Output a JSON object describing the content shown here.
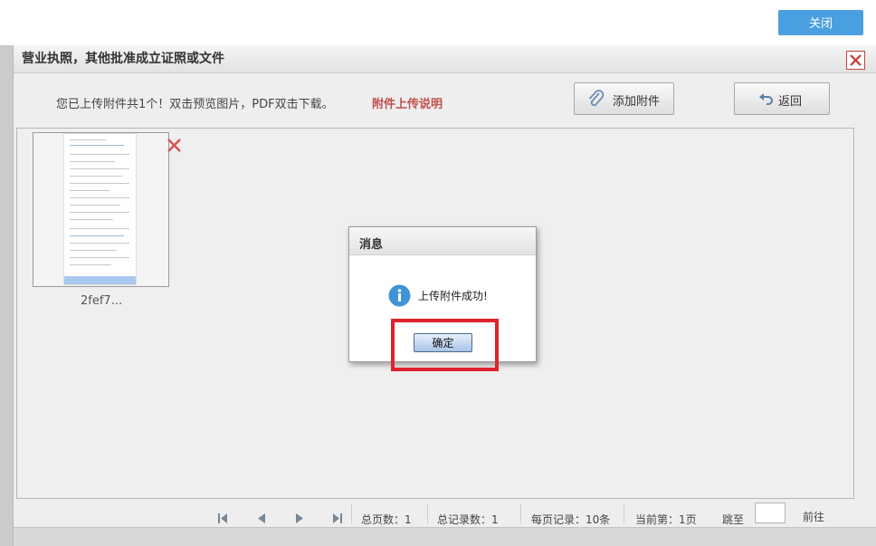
{
  "topbar": {
    "close_label": "关闭"
  },
  "window": {
    "title": "营业执照，其他批准成立证照或文件",
    "info_text": "您已上传附件共1个！双击预览图片，PDF双击下载。",
    "upload_note": "附件上传说明",
    "add_button": "添加附件",
    "back_button": "返回"
  },
  "files": [
    {
      "name": "2fef7..."
    }
  ],
  "pager": {
    "total_pages": "总页数：1",
    "total_records": "总记录数：1",
    "per_page": "每页记录：10条",
    "current_page": "当前第：1页",
    "jump_to": "跳至",
    "go": "前往"
  },
  "dialog": {
    "title": "消息",
    "message": "上传附件成功!",
    "ok_label": "确定"
  },
  "colors": {
    "accent": "#4a9fe0",
    "note_red": "#c0504d",
    "highlight_red": "#e0222b"
  }
}
